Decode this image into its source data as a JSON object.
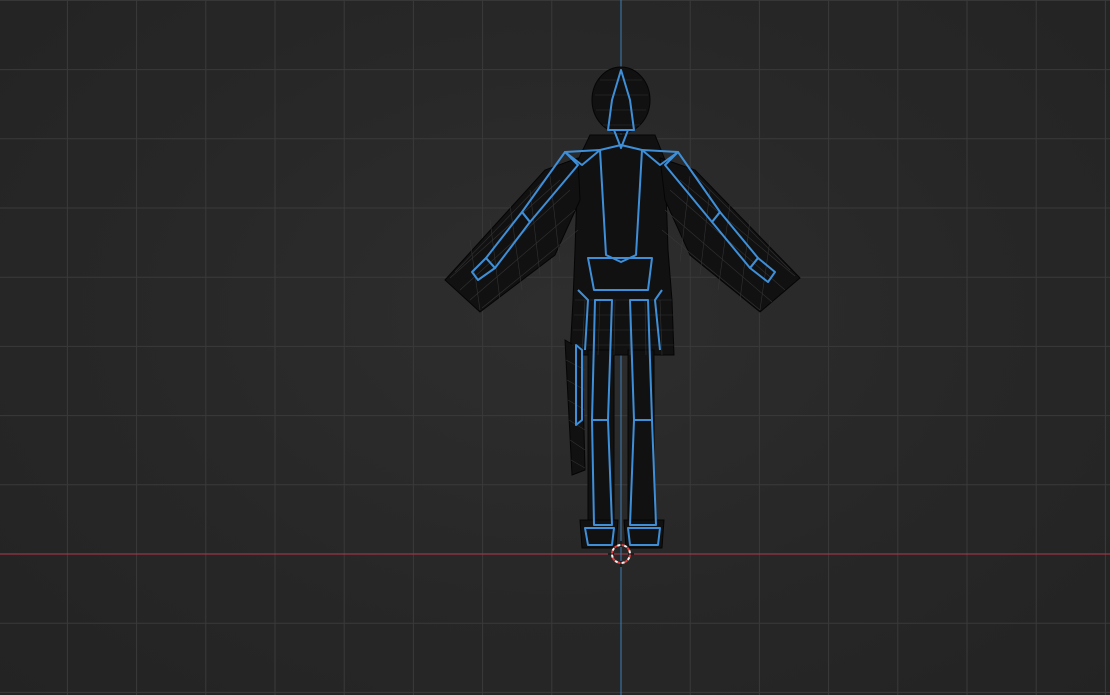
{
  "viewport": {
    "background_color": "#282828",
    "grid_color": "#3a3a3a",
    "x_axis_color": "#b3384a",
    "z_axis_color": "#3d7fb8",
    "armature_color": "#3f8fd8",
    "mesh_color": "#0c0c0c",
    "cursor_color": "#e04040",
    "icons": [
      "3d-cursor-icon"
    ]
  }
}
